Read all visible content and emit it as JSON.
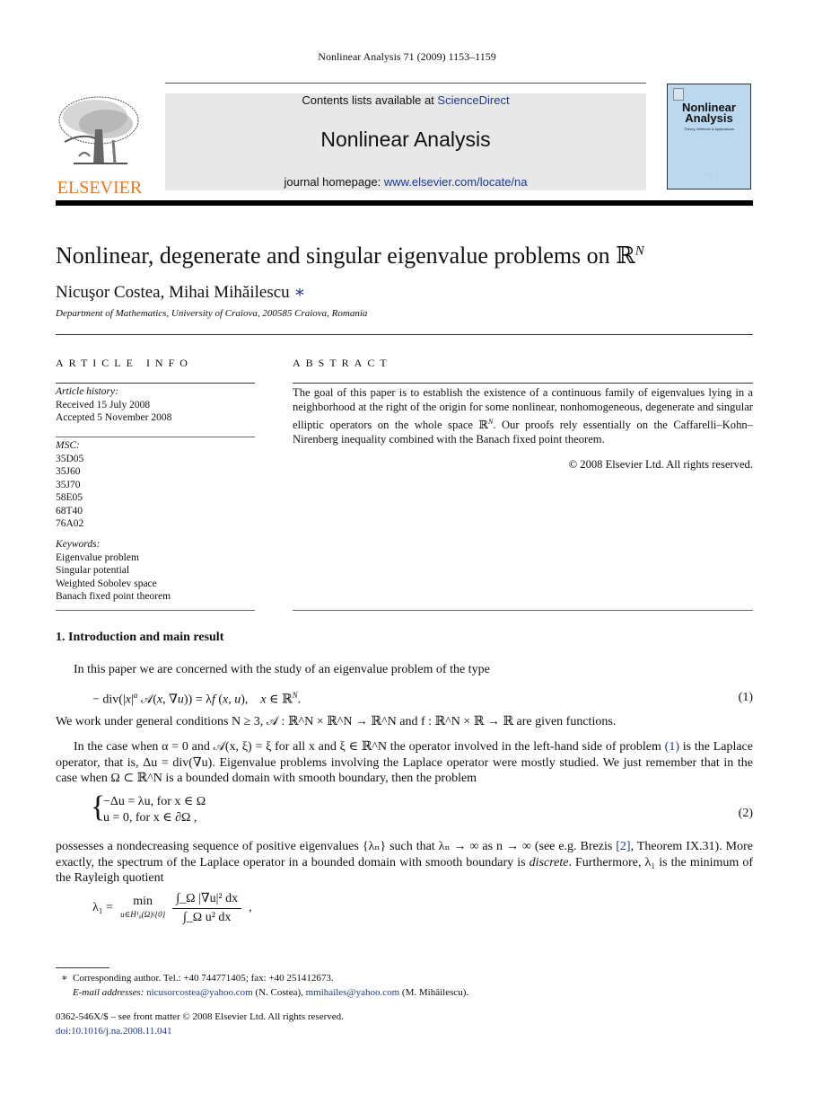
{
  "running_head": "Nonlinear Analysis 71 (2009) 1153–1159",
  "header": {
    "publisher_logo_text": "ELSEVIER",
    "contents_prefix": "Contents lists available at ",
    "contents_link": "ScienceDirect",
    "journal_name": "Nonlinear Analysis",
    "homepage_prefix": "journal homepage: ",
    "homepage_link": "www.elsevier.com/locate/na",
    "cover_title_line1": "Nonlinear",
    "cover_title_line2": "Analysis",
    "cover_subtitle": "Theory, Methods & Applications",
    "colors": {
      "elsevier_orange": "#e07a26",
      "link_blue": "#1e3a8a",
      "banner_gray": "#e8e8e8",
      "cover_blue": "#bcd8ef"
    }
  },
  "article": {
    "title": "Nonlinear, degenerate and singular eigenvalue problems on ℝ",
    "title_sup": "N",
    "authors": "Nicuşor Costea, Mihai Mihăilescu",
    "author_mark": "∗",
    "affiliation": "Department of Mathematics, University of Craiova, 200585 Craiova, Romania"
  },
  "article_info": {
    "label": "ARTICLE INFO",
    "history_head": "Article history:",
    "received": "Received 15 July 2008",
    "accepted": "Accepted 5 November 2008",
    "msc_head": "MSC:",
    "msc": [
      "35D05",
      "35J60",
      "35J70",
      "58E05",
      "68T40",
      "76A02"
    ],
    "keywords_head": "Keywords:",
    "keywords": [
      "Eigenvalue problem",
      "Singular potential",
      "Weighted Sobolev space",
      "Banach fixed point theorem"
    ]
  },
  "abstract": {
    "label": "ABSTRACT",
    "text_part1": "The goal of this paper is to establish the existence of a continuous family of eigenvalues lying in a neighborhood at the right of the origin for some nonlinear, nonhomogeneous, degenerate and singular elliptic operators on the whole space ℝ",
    "text_sup": "N",
    "text_part2": ". Our proofs rely essentially on the Caffarelli–Kohn–Nirenberg inequality combined with the Banach fixed point theorem.",
    "copyright": "© 2008 Elsevier Ltd. All rights reserved."
  },
  "body": {
    "section_heading": "1.  Introduction and main result",
    "p1": "In this paper we are concerned with the study of an eigenvalue problem of the type",
    "eq1": "− div(|x|^α 𝒜(x, ∇u)) = λf (x, u),    x ∈ ℝ^N.",
    "eq1_num": "(1)",
    "p2": "We work under general conditions N ≥ 3, 𝒜 : ℝ^N × ℝ^N → ℝ^N and f : ℝ^N × ℝ → ℝ are given functions.",
    "p3_a": "In the case when α = 0 and 𝒜(x, ξ) = ξ for all x and ξ ∈ ℝ^N the operator involved in the left-hand side of problem ",
    "p3_ref": "(1)",
    "p3_b": " is the Laplace operator, that is, Δu = div(∇u). Eigenvalue problems involving the Laplace operator were mostly studied. We just remember that in the case when Ω ⊂ ℝ^N is a bounded domain with smooth boundary, then the problem",
    "eq2_line1": "−Δu = λu,     for x ∈ Ω",
    "eq2_line2": "u = 0,      for x ∈ ∂Ω ,",
    "eq2_num": "(2)",
    "p4_a": "possesses a nondecreasing sequence of positive eigenvalues {λₙ} such that λₙ → ∞ as n → ∞ (see e.g. Brezis ",
    "p4_ref": "[2]",
    "p4_b": ", Theorem IX.31). More exactly, the spectrum of the Laplace operator in a bounded domain with smooth boundary is ",
    "p4_em": "discrete",
    "p4_c": ". Furthermore, λ₁ is the minimum of the Rayleigh quotient",
    "eq3_lhs": "λ₁ =",
    "eq3_min": "min",
    "eq3_under": "u∈H¹₀(Ω)\\{0}",
    "eq3_num": "∫_Ω |∇u|² dx",
    "eq3_den": "∫_Ω u² dx",
    "eq3_tail": ","
  },
  "footnotes": {
    "mark": "∗",
    "corresponding": "Corresponding author. Tel.: +40 744771405; fax: +40 251412673.",
    "email_label": "E-mail addresses: ",
    "email1": "nicusorcostea@yahoo.com",
    "email1_name": " (N. Costea), ",
    "email2": "mmihailes@yahoo.com",
    "email2_name": " (M. Mihăilescu).",
    "issn": "0362-546X/$ – see front matter © 2008 Elsevier Ltd. All rights reserved.",
    "doi": "doi:10.1016/j.na.2008.11.041"
  }
}
